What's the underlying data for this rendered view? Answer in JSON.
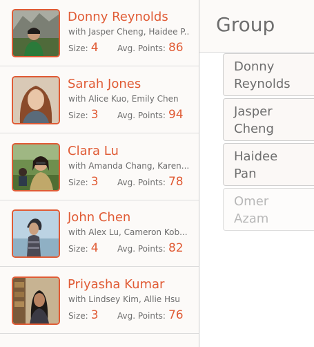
{
  "groups": [
    {
      "name": "Donny Reynolds",
      "members": "with Jasper Cheng, Haidee P..",
      "size_label": "Size:",
      "size": "4",
      "avg_label": "Avg. Points:",
      "avg": "86",
      "avatar_icon": "person-photo"
    },
    {
      "name": "Sarah Jones",
      "members": "with Alice Kuo, Emily Chen",
      "size_label": "Size:",
      "size": "3",
      "avg_label": "Avg. Points:",
      "avg": "94",
      "avatar_icon": "person-photo"
    },
    {
      "name": "Clara Lu",
      "members": "with Amanda Chang, Karen...",
      "size_label": "Size:",
      "size": "3",
      "avg_label": "Avg. Points:",
      "avg": "78",
      "avatar_icon": "person-photo"
    },
    {
      "name": "John Chen",
      "members": "with Alex Lu, Cameron Kob...",
      "size_label": "Size:",
      "size": "4",
      "avg_label": "Avg. Points:",
      "avg": "82",
      "avatar_icon": "person-photo"
    },
    {
      "name": "Priyasha Kumar",
      "members": "with Lindsey Kim, Allie Hsu",
      "size_label": "Size:",
      "size": "3",
      "avg_label": "Avg. Points:",
      "avg": "76",
      "avatar_icon": "person-photo"
    }
  ],
  "detail": {
    "title": "Group",
    "members": [
      {
        "first": "Donny",
        "last": "Reynolds",
        "state": "enabled"
      },
      {
        "first": "Jasper",
        "last": "Cheng",
        "state": "enabled"
      },
      {
        "first": "Haidee",
        "last": "Pan",
        "state": "enabled"
      },
      {
        "first": "Omer",
        "last": "Azam",
        "state": "disabled"
      }
    ]
  },
  "colors": {
    "accent": "#e05b35",
    "text_muted": "#6e6e6e",
    "text_disabled": "#b8b8b8",
    "panel_bg": "#fcfaf8"
  }
}
